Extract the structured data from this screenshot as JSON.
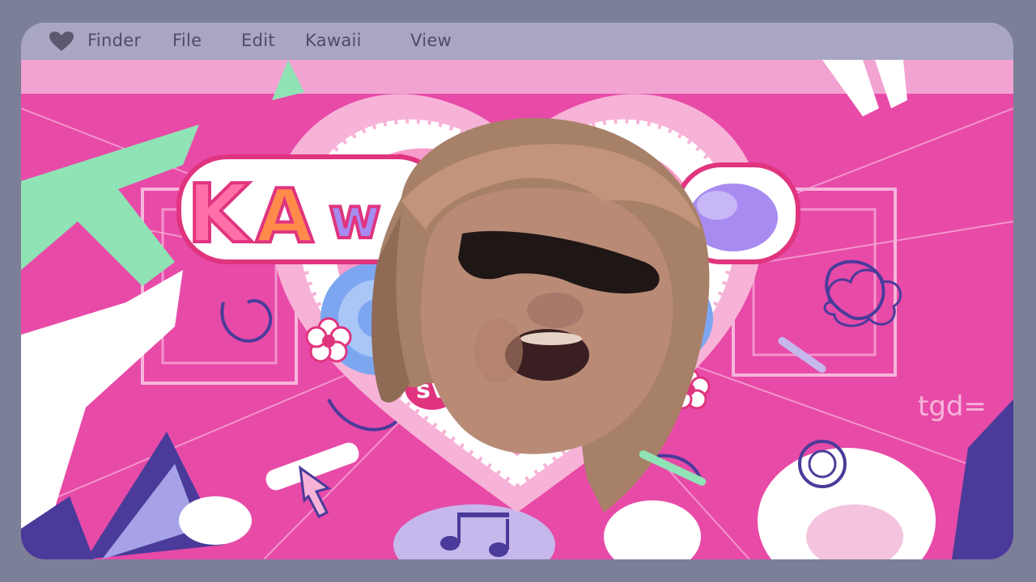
{
  "menubar": {
    "items": [
      "Finder",
      "File",
      "Edit",
      "Kawaii",
      "View"
    ]
  },
  "video": {
    "title_art": "KAWAII",
    "small_stamp": "sV",
    "corner_scribble": "tgd="
  },
  "colors": {
    "background": "#7b7f98",
    "menubar": "#a9a6c4",
    "menu_text": "#4f4c6a",
    "accent_pink": "#e84aa8",
    "accent_purple": "#4a3b9a",
    "accent_mint": "#8fe3b5"
  },
  "icons": [
    "heart-icon",
    "cursor-arrow-icon",
    "music-note-icon",
    "flower-icon",
    "cloud-icon"
  ]
}
